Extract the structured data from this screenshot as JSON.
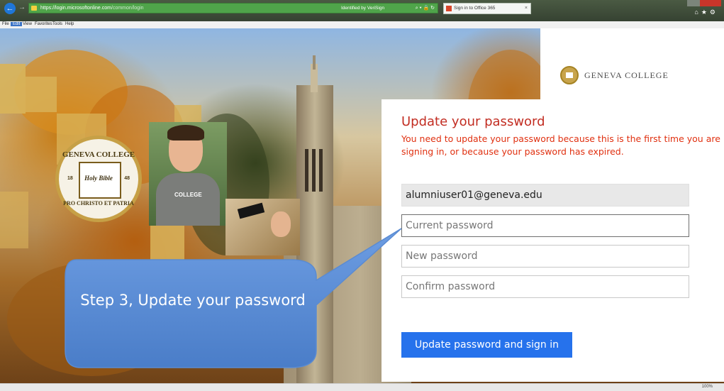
{
  "browser": {
    "url_scheme": "https://",
    "url_host": "login.microsoftonline.com",
    "url_path": "/common/login",
    "address_controls": "⌕ ▾ 🔒 ↻",
    "verified_text": "Identified by VeriSign",
    "tab_title": "Sign in to Office 365",
    "tab_close": "×",
    "menu": {
      "file": "File",
      "edit": "Edit",
      "view": "View",
      "favorites": "Favorites",
      "tools": "Tools",
      "help": "Help"
    },
    "right_icons": "⌂★⚙",
    "zoom": "100%"
  },
  "seal": {
    "top_text": "GENEVA COLLEGE",
    "book_text": "Holy Bible",
    "year_left": "18",
    "year_right": "48",
    "motto": "PRO CHRISTO ET PATRIA"
  },
  "student": {
    "shirt_text": "COLLEGE"
  },
  "brand": {
    "name": "GENEVA COLLEGE"
  },
  "form": {
    "title": "Update your password",
    "description": "You need to update your password because this is the first time you are signing in, or because your password has expired.",
    "email_value": "alumniuser01@geneva.edu",
    "current_placeholder": "Current password",
    "new_placeholder": "New password",
    "confirm_placeholder": "Confirm password",
    "submit_label": "Update password and sign in"
  },
  "callout": {
    "text": "Step 3, Update your password",
    "fill_color": "#5b8fd9"
  },
  "colors": {
    "title_red": "#c22d22",
    "desc_red": "#e03010",
    "button_blue": "#2672ec"
  }
}
